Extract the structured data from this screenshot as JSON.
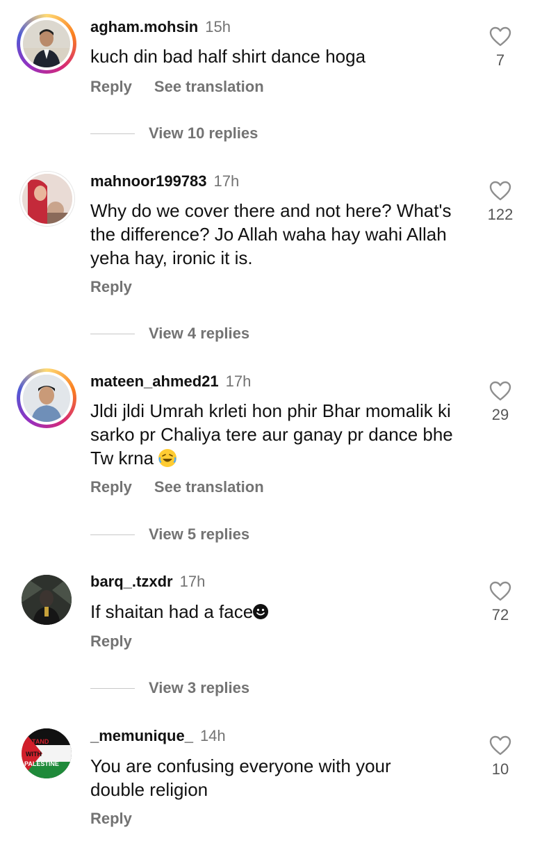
{
  "comments": [
    {
      "username": "agham.mohsin",
      "time": "15h",
      "text": "kuch din bad half shirt dance hoga",
      "likes": "7",
      "reply": "Reply",
      "translate": "See translation",
      "view_replies": "View 10 replies"
    },
    {
      "username": "mahnoor199783",
      "time": "17h",
      "text": "Why do we cover there and not here? What's the difference? Jo Allah waha hay wahi Allah yeha hay, ironic it is.",
      "likes": "122",
      "reply": "Reply",
      "view_replies": "View 4 replies"
    },
    {
      "username": "mateen_ahmed21",
      "time": "17h",
      "text": "Jldi jldi Umrah krleti hon phir Bhar momalik ki sarko pr Chaliya tere aur ganay pr dance bhe Tw krna",
      "likes": "29",
      "reply": "Reply",
      "translate": "See translation",
      "view_replies": "View 5 replies"
    },
    {
      "username": "barq_.tzxdr",
      "time": "17h",
      "text": "If shaitan had a face",
      "likes": "72",
      "reply": "Reply",
      "view_replies": "View 3 replies"
    },
    {
      "username": "_memunique_",
      "time": "14h",
      "text": "You are confusing everyone with your double religion",
      "likes": "10",
      "reply": "Reply",
      "avatar_text": "I STAND WITH PALESTINE"
    }
  ],
  "icons": {
    "like": "heart-outline-icon",
    "laugh": "laughing-emoji-icon",
    "smile": "smiling-face-icon"
  },
  "colors": {
    "secondary_text": "#737373",
    "story_ring": [
      "#feda75",
      "#fa7e1e",
      "#d62976",
      "#962fbf",
      "#4f5bd5"
    ]
  }
}
